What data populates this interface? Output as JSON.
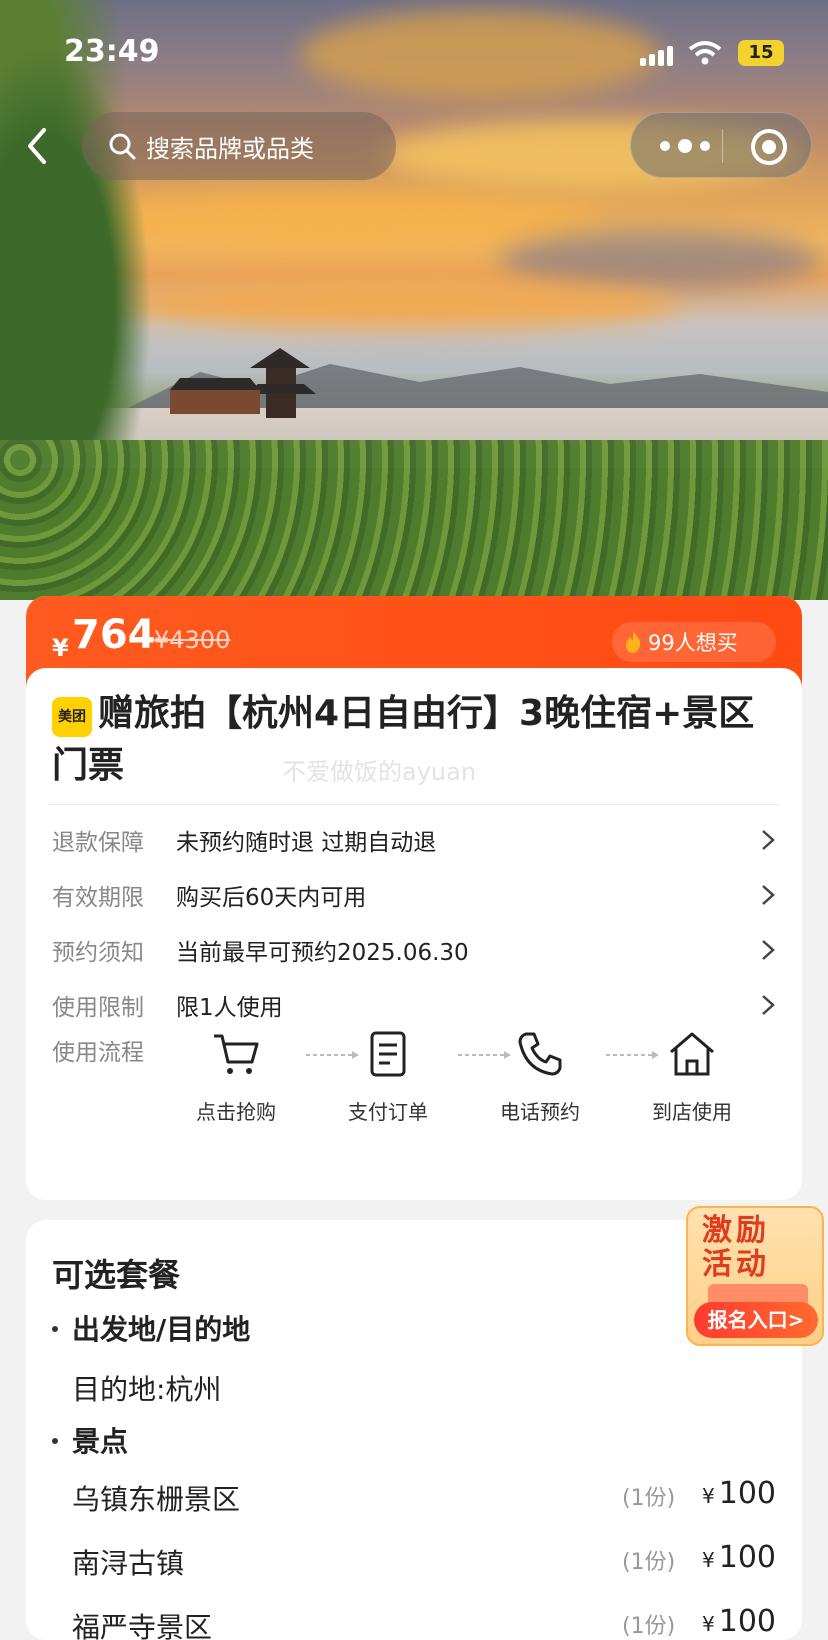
{
  "status_bar": {
    "time": "23:49",
    "battery": "15"
  },
  "nav": {
    "search_placeholder": "搜索品牌或品类"
  },
  "price": {
    "currency": "¥",
    "current": "764",
    "original": "¥4300",
    "want_buy": "99人想买"
  },
  "product": {
    "brand_badge": "美团",
    "title": "赠旅拍【杭州4日自由行】3晚住宿+景区门票",
    "watermark": "不爱做饭的ayuan"
  },
  "info_rows": [
    {
      "label": "退款保障",
      "value": "未预约随时退 过期自动退"
    },
    {
      "label": "有效期限",
      "value": "购买后60天内可用"
    },
    {
      "label": "预约须知",
      "value": "当前最早可预约2025.06.30"
    },
    {
      "label": "使用限制",
      "value": "限1人使用"
    }
  ],
  "usage_flow": {
    "label": "使用流程",
    "steps": [
      "点击抢购",
      "支付订单",
      "电话预约",
      "到店使用"
    ]
  },
  "packages": {
    "title": "可选套餐",
    "section_origin": "出发地/目的地",
    "destination": "目的地:杭州",
    "section_spots": "景点",
    "items": [
      {
        "name": "乌镇东栅景区",
        "count": "(1份)",
        "currency": "¥",
        "price": "100"
      },
      {
        "name": "南浔古镇",
        "count": "(1份)",
        "currency": "¥",
        "price": "100"
      },
      {
        "name": "福严寺景区",
        "count": "(1份)",
        "currency": "¥",
        "price": "100"
      }
    ]
  },
  "promo": {
    "line1": "激励",
    "line2": "活动",
    "button": "报名入口>"
  },
  "colors": {
    "accent": "#ff4a12",
    "brand": "#ffd100"
  }
}
